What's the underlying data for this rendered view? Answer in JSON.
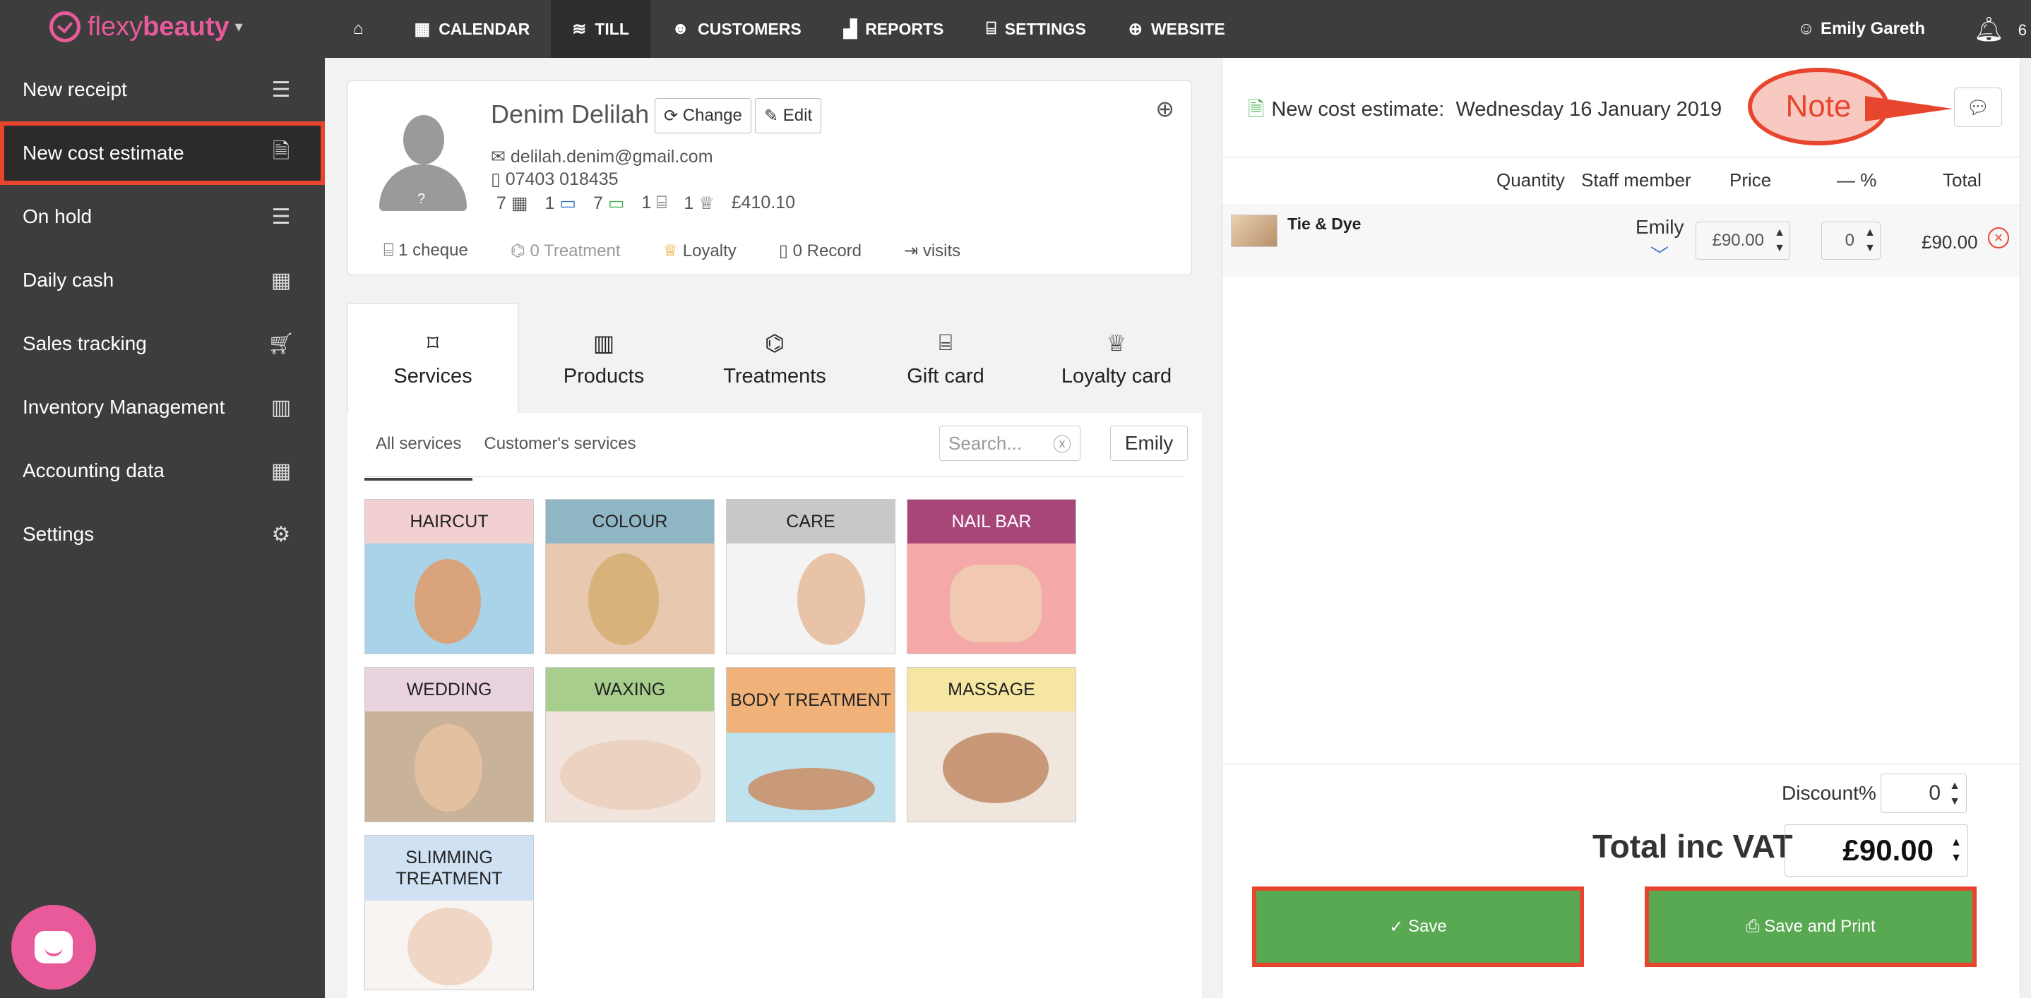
{
  "brand": {
    "name_light": "flexy",
    "name_bold": "beauty"
  },
  "nav": {
    "items": [
      {
        "label": "",
        "icon": "home-icon",
        "glyph": "⌂"
      },
      {
        "label": "CALENDAR",
        "icon": "calendar-icon",
        "glyph": "▦"
      },
      {
        "label": "TILL",
        "icon": "coins-icon",
        "glyph": "≋"
      },
      {
        "label": "CUSTOMERS",
        "icon": "users-icon",
        "glyph": "☻"
      },
      {
        "label": "REPORTS",
        "icon": "chart-icon",
        "glyph": "▟"
      },
      {
        "label": "SETTINGS",
        "icon": "shop-icon",
        "glyph": "⌸"
      },
      {
        "label": "WEBSITE",
        "icon": "globe-icon",
        "glyph": "⊕"
      }
    ],
    "user": "Emily Gareth",
    "notifications": "6"
  },
  "sidebar": {
    "items": [
      {
        "label": "New receipt",
        "glyph": "☰"
      },
      {
        "label": "New cost estimate",
        "glyph": "🗎"
      },
      {
        "label": "On hold",
        "glyph": "☰"
      },
      {
        "label": "Daily cash",
        "glyph": "▦"
      },
      {
        "label": "Sales tracking",
        "glyph": "🛒"
      },
      {
        "label": "Inventory Management",
        "glyph": "▥"
      },
      {
        "label": "Accounting data",
        "glyph": "▦"
      },
      {
        "label": "Settings",
        "glyph": "⚙"
      }
    ]
  },
  "client": {
    "name": "Denim Delilah",
    "change_label": "Change",
    "edit_label": "Edit",
    "email": "delilah.denim@gmail.com",
    "phone": "07403 018435",
    "stats": [
      "7",
      "1",
      "7",
      "1",
      "1",
      "£410.10"
    ],
    "links": [
      "1 cheque",
      "0 Treatment",
      "Loyalty",
      "0 Record",
      "visits"
    ]
  },
  "tabs": [
    "Services",
    "Products",
    "Treatments",
    "Gift card",
    "Loyalty card"
  ],
  "catalog": {
    "subtabs": [
      "All services",
      "Customer's services"
    ],
    "search_placeholder": "Search...",
    "staff_filter": "Emily",
    "categories": [
      {
        "label": "HAIRCUT",
        "color": "#f2cfd0",
        "bg": "#a9d3e8"
      },
      {
        "label": "COLOUR",
        "color": "#8fb6c4",
        "bg": "#e8c9b0"
      },
      {
        "label": "CARE",
        "color": "#c8c8c8",
        "bg": "#f3f3f3"
      },
      {
        "label": "NAIL BAR",
        "color": "#a8467a",
        "bg": "#f4a8a8"
      },
      {
        "label": "WEDDING",
        "color": "#e9d3df",
        "bg": "#c9b29a"
      },
      {
        "label": "WAXING",
        "color": "#a7ce8c",
        "bg": "#f1e4dc"
      },
      {
        "label": "BODY TREATMENT",
        "color": "#f1b27a",
        "bg": "#bfe2ef"
      },
      {
        "label": "MASSAGE",
        "color": "#f5e6a2",
        "bg": "#efe6de"
      },
      {
        "label": "SLIMMING TREATMENT",
        "color": "#cfe1f3",
        "bg": "#f8f4f1"
      }
    ]
  },
  "estimate": {
    "title_prefix": "New cost estimate:",
    "date": "Wednesday 16 January 2019",
    "note_callout": "Note",
    "columns": [
      "Quantity",
      "Staff member",
      "Price",
      "— %",
      "Total"
    ],
    "line": {
      "name": "Tie & Dye",
      "staff": "Emily",
      "price": "£90.00",
      "discount": "0",
      "total": "£90.00"
    },
    "discount_label": "Discount%",
    "discount_value": "0",
    "total_label": "Total inc VAT",
    "total_value": "£90.00",
    "save_label": "Save",
    "save_print_label": "Save and Print"
  }
}
